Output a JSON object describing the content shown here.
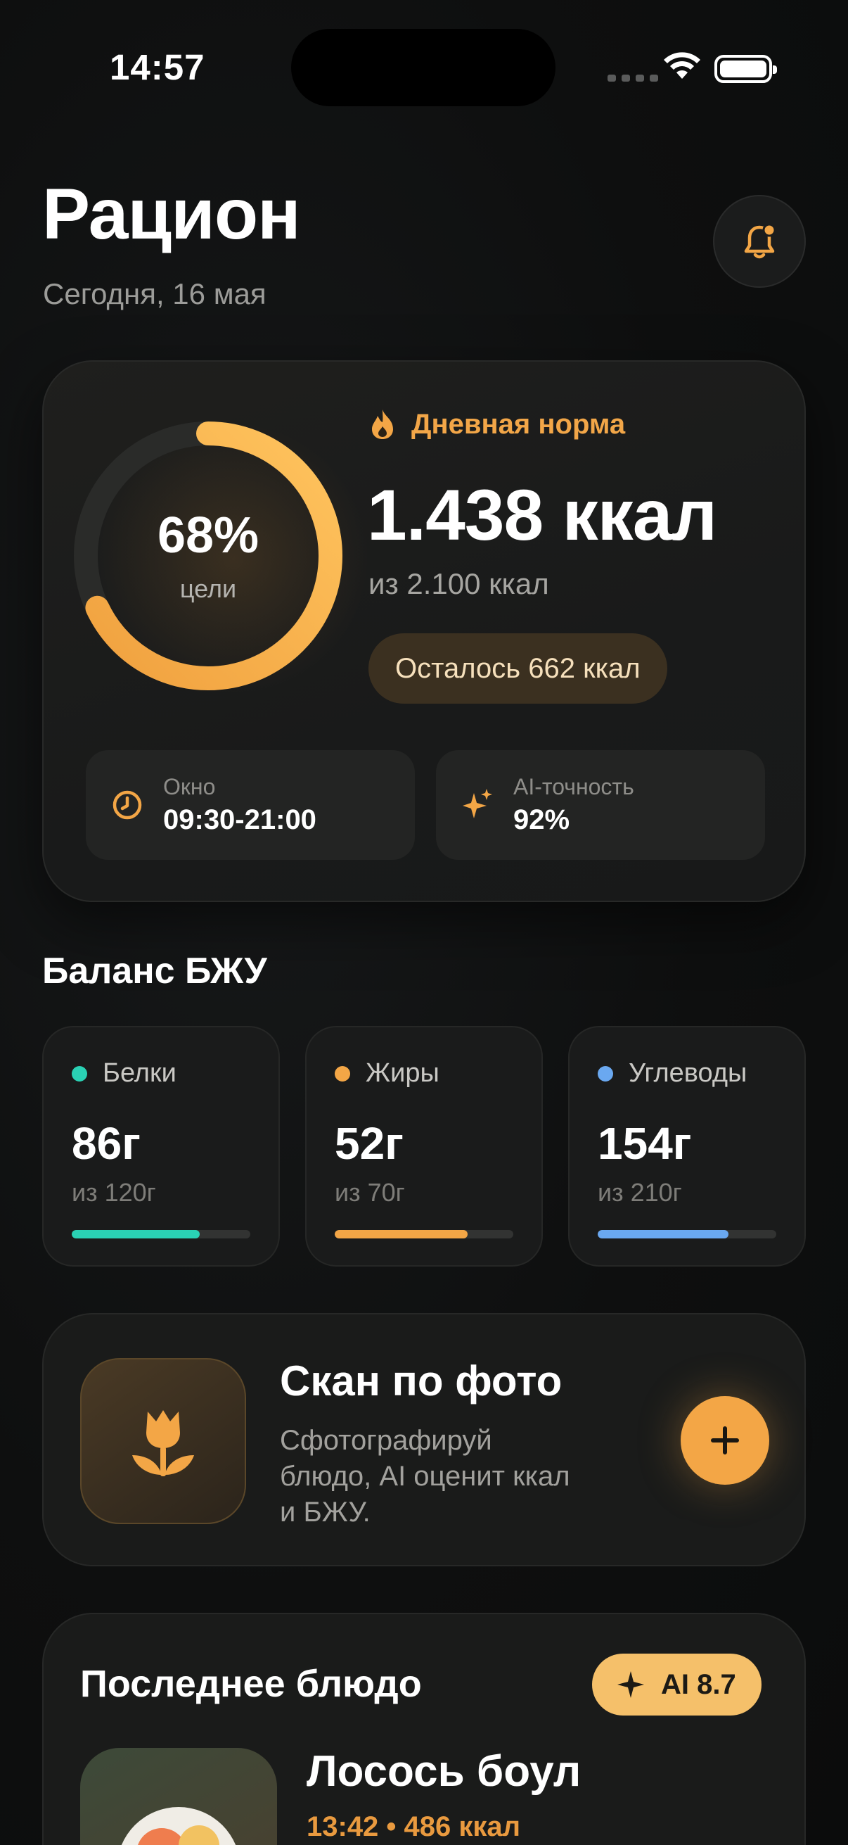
{
  "status_bar": {
    "time": "14:57"
  },
  "header": {
    "title": "Рацион",
    "date": "Сегодня, 16 мая"
  },
  "daily": {
    "label": "Дневная норма",
    "percent_text": "68%",
    "percent_caption": "цели",
    "progress": 0.68,
    "kcal": "1.438 ккал",
    "of_total": "из 2.100 ккал",
    "remaining": "Осталось 662 ккал",
    "window_label": "Окно",
    "window_value": "09:30-21:00",
    "ai_label": "AI-точность",
    "ai_value": "92%",
    "accent_color": "#f3a646"
  },
  "macros": {
    "title": "Баланс БЖУ",
    "items": [
      {
        "name": "Белки",
        "value": "86г",
        "of": "из 120г",
        "progress": 0.717,
        "color": "#2ad1b4"
      },
      {
        "name": "Жиры",
        "value": "52г",
        "of": "из 70г",
        "progress": 0.743,
        "color": "#f3a646"
      },
      {
        "name": "Углеводы",
        "value": "154г",
        "of": "из 210г",
        "progress": 0.733,
        "color": "#6aa8f0"
      }
    ]
  },
  "scan": {
    "title": "Скан по фото",
    "description": "Сфотографируй блюдо, AI оценит ккал и БЖУ."
  },
  "last_meal": {
    "title": "Последнее блюдо",
    "ai_score": "AI 8.7",
    "name": "Лосось боул",
    "meta": "13:42 • 486 ккал"
  }
}
